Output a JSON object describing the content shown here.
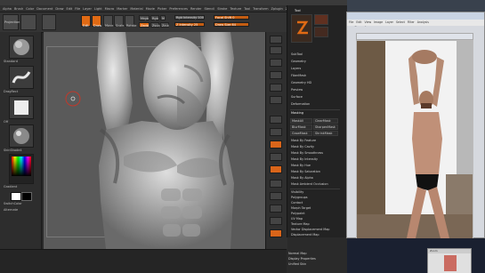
{
  "app": {
    "title": "ZBrush 4R5 - ZBrush 4R5 (GPL) - Document - Free Mem 3.4GB - Active Mem 4.54MB"
  },
  "menu": [
    "Alpha",
    "Brush",
    "Color",
    "Document",
    "Draw",
    "Edit",
    "File",
    "Layer",
    "Light",
    "Macro",
    "Marker",
    "Material",
    "Movie",
    "Picker",
    "Preferences",
    "Render",
    "Stencil",
    "Stroke",
    "Texture",
    "Tool",
    "Transform",
    "Zplugin",
    "Zscript"
  ],
  "topbar": {
    "labels": [
      "Projection",
      "Master",
      "Edit",
      "Draw",
      "Move",
      "Scale",
      "Rotate"
    ],
    "mrgb": "Mrgb",
    "rgb": "Rgb",
    "m": "M",
    "zadd": "Zadd",
    "zsub": "Zsub",
    "zcut": "Zcut",
    "focal_shift": "Focal Shift 0",
    "draw_size": "Draw Size 64",
    "z_intensity": "Z Intensity 25",
    "rgb_intensity": "Rgb Intensity 100"
  },
  "left_shelf": {
    "brush_label": "Standard",
    "stroke_label": "DragRect",
    "alpha_label": "Off",
    "texture_label": "Off",
    "material_label": "SkinShade4",
    "gradient_label": "Gradient",
    "switch_label": "SwitchColor",
    "alternate_label": "Alternate"
  },
  "tray": {
    "header": "Tool",
    "items": [
      "SubTool",
      "Geometry",
      "Layers",
      "FiberMesh",
      "Geometry HD",
      "Preview",
      "Surface",
      "Deformation",
      "Masking",
      "Visibility",
      "Polygroups",
      "Contact",
      "Morph Target",
      "Polypaint",
      "UV Map",
      "Texture Map",
      "Vector Displacement Map",
      "Displacement Map",
      "Normal Map",
      "Display Properties",
      "Unified Skin"
    ],
    "mask_rows": [
      [
        "MaskAll",
        "ClearMask"
      ],
      [
        "BlurMask",
        "SharpenMask"
      ],
      [
        "GrowMask",
        "ShrinkMask"
      ],
      [
        "Mask By Feature"
      ],
      [
        "Mask By Cavity"
      ],
      [
        "Mask By Smoothness"
      ],
      [
        "Mask By Intensity"
      ],
      [
        "Mask By Hue"
      ],
      [
        "Mask By Saturation"
      ],
      [
        "Mask By Alpha"
      ],
      [
        "Mask Ambient Occlusion"
      ]
    ]
  },
  "photo_window": {
    "title": "IMG_2298.JPG - Windows Photo Viewer",
    "menu": [
      "File",
      "Edit",
      "View",
      "Image",
      "Layer",
      "Select",
      "Filter",
      "Analysis",
      "3D",
      "View",
      "Window",
      "Help"
    ],
    "tab": "IMG_2298.JPG @ 16.7%"
  },
  "thumb": {
    "title": "Zoom"
  },
  "colors": {
    "accent": "#e06a14",
    "panel": "#2a2a2a",
    "canvas": "#5a5a5a"
  }
}
